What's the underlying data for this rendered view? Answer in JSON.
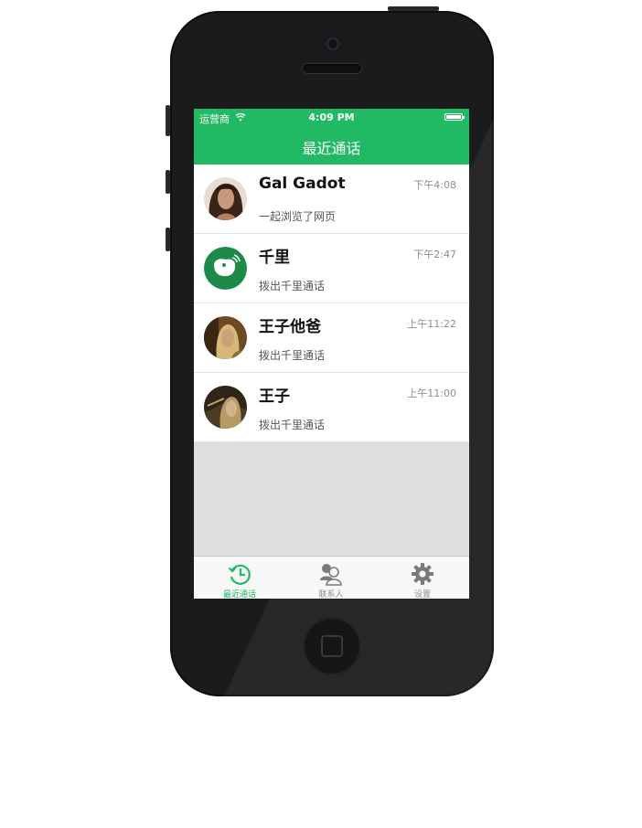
{
  "status_bar": {
    "carrier": "运营商",
    "time": "4:09 PM"
  },
  "nav": {
    "title": "最近通话"
  },
  "calls": [
    {
      "name": "Gal Gadot",
      "time": "下午4:08",
      "subtitle": "一起浏览了网页",
      "avatar": "photo-avatar"
    },
    {
      "name": "千里",
      "time": "下午2:47",
      "subtitle": "拨出千里通话",
      "avatar": "app-logo-avatar"
    },
    {
      "name": "王子他爸",
      "time": "上午11:22",
      "subtitle": "拨出千里通话",
      "avatar": "photo-avatar"
    },
    {
      "name": "王子",
      "time": "上午11:00",
      "subtitle": "拨出千里通话",
      "avatar": "photo-avatar"
    }
  ],
  "tabs": [
    {
      "label": "最近通话",
      "icon": "history-clock-icon",
      "active": true
    },
    {
      "label": "联系人",
      "icon": "contacts-icon",
      "active": false
    },
    {
      "label": "设置",
      "icon": "gear-icon",
      "active": false
    }
  ],
  "colors": {
    "accent": "#22b964",
    "list_background": "#dfdfdf",
    "tab_inactive": "#8e8e8e"
  }
}
